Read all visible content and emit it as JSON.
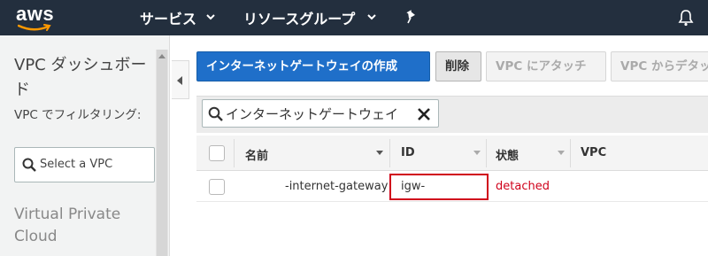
{
  "nav": {
    "logo_text": "aws",
    "services_label": "サービス",
    "resource_groups_label": "リソースグループ",
    "icons": [
      "chevron-down-icon",
      "pin-icon",
      "bell-icon"
    ]
  },
  "sidebar": {
    "title": "VPC ダッシュボード",
    "filter_label": "VPC でフィルタリング:",
    "vpc_select_placeholder": "Select a VPC",
    "section": "Virtual Private Cloud"
  },
  "toolbar": {
    "create_label": "インターネットゲートウェイの作成",
    "delete_label": "削除",
    "attach_label": "VPC にアタッチ",
    "detach_label": "VPC からデタッ"
  },
  "search": {
    "value": "インターネットゲートウェイ"
  },
  "table": {
    "columns": [
      "名前",
      "ID",
      "状態",
      "VPC"
    ],
    "rows": [
      {
        "name": "-internet-gateway",
        "id": "igw-",
        "state": "detached",
        "vpc": ""
      }
    ]
  },
  "colors": {
    "nav_bg": "#232f3e",
    "primary_button": "#1f6fc9",
    "status_detached": "#d0021b",
    "highlight_border": "#d0021b"
  }
}
